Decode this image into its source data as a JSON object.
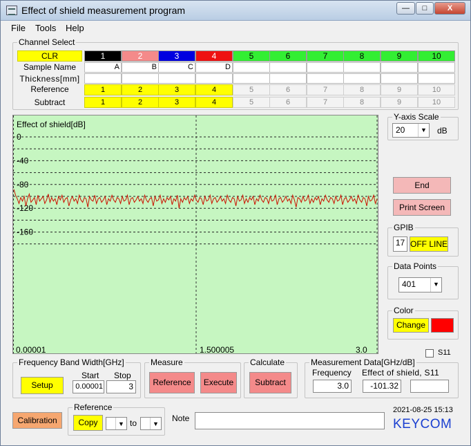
{
  "window": {
    "title": "Effect of shield measurement program",
    "minimize_label": "—",
    "maximize_label": "□",
    "close_label": "X"
  },
  "menu": {
    "file": "File",
    "tools": "Tools",
    "help": "Help"
  },
  "channel_select": {
    "title": "Channel Select",
    "clr_label": "CLR",
    "row_labels": {
      "sample_name": "Sample Name",
      "thickness": "Thickness[mm]",
      "reference": "Reference",
      "subtract": "Subtract"
    },
    "channels": [
      {
        "label": "1",
        "color": "#000000",
        "text_color": "#ffffff",
        "sample_name": "A",
        "reference": "1",
        "subtract": "1"
      },
      {
        "label": "2",
        "color": "#f48a8a",
        "text_color": "#ffffff",
        "sample_name": "B",
        "reference": "2",
        "subtract": "2"
      },
      {
        "label": "3",
        "color": "#0000e0",
        "text_color": "#ffffff",
        "sample_name": "C",
        "reference": "3",
        "subtract": "3"
      },
      {
        "label": "4",
        "color": "#ee1111",
        "text_color": "#ffffff",
        "sample_name": "D",
        "reference": "4",
        "subtract": "4"
      },
      {
        "label": "5",
        "color": "#33ee33",
        "text_color": "#000000",
        "sample_name": "",
        "reference": "5",
        "subtract": "5"
      },
      {
        "label": "6",
        "color": "#33ee33",
        "text_color": "#000000",
        "sample_name": "",
        "reference": "6",
        "subtract": "6"
      },
      {
        "label": "7",
        "color": "#33ee33",
        "text_color": "#000000",
        "sample_name": "",
        "reference": "7",
        "subtract": "7"
      },
      {
        "label": "8",
        "color": "#33ee33",
        "text_color": "#000000",
        "sample_name": "",
        "reference": "8",
        "subtract": "8"
      },
      {
        "label": "9",
        "color": "#33ee33",
        "text_color": "#000000",
        "sample_name": "",
        "reference": "9",
        "subtract": "9"
      },
      {
        "label": "10",
        "color": "#33ee33",
        "text_color": "#000000",
        "sample_name": "",
        "reference": "10",
        "subtract": "10"
      }
    ]
  },
  "chart_data": {
    "type": "line",
    "title": "",
    "ylabel": "Effect of shield[dB]",
    "xlabel": "",
    "y_ticks": [
      "0",
      "-40",
      "-80",
      "-120",
      "-160"
    ],
    "x_ticks": [
      "0.00001",
      "1.500005",
      "3.0"
    ],
    "ylim": [
      -180,
      0
    ],
    "xlim": [
      1e-05,
      3.0
    ],
    "grid": true,
    "background": "#c6f6c1",
    "series": [
      {
        "color": "#cc1100",
        "y": [
          -88,
          -98,
          -104,
          -112,
          -102,
          -108,
          -100,
          -116,
          -104,
          -96,
          -110,
          -106,
          -102,
          -114,
          -98,
          -108,
          -104,
          -100,
          -112,
          -106,
          -96,
          -110,
          -102,
          -108,
          -104,
          -114,
          -100,
          -106,
          -98,
          -110,
          -104,
          -102,
          -116,
          -106,
          -100,
          -108,
          -104,
          -112,
          -98,
          -106,
          -110,
          -102,
          -104,
          -118,
          -100,
          -106,
          -108,
          -98,
          -112,
          -104,
          -102,
          -110,
          -106,
          -100,
          -114,
          -104,
          -108,
          -98,
          -106,
          -110,
          -102,
          -104,
          -112,
          -100,
          -108,
          -106,
          -98,
          -114,
          -104,
          -102,
          -110,
          -106,
          -100,
          -108,
          -104,
          -112,
          -98,
          -106,
          -110,
          -104,
          -102,
          -116,
          -100,
          -108,
          -106,
          -98,
          -112,
          -104,
          -110,
          -102,
          -106,
          -100,
          -114,
          -104,
          -108,
          -98,
          -120,
          -104,
          -110,
          -102,
          -106,
          -100,
          -112,
          -104,
          -108,
          -98,
          -106,
          -110,
          -102,
          -104,
          -114,
          -100,
          -108,
          -106,
          -98,
          -112,
          -104,
          -102,
          -110,
          -106,
          -100,
          -108,
          -104,
          -112,
          -98,
          -106,
          -110,
          -102,
          -104,
          -116,
          -100,
          -108,
          -106,
          -98,
          -112,
          -104,
          -110,
          -102,
          -106,
          -100,
          -114,
          -104,
          -108,
          -98,
          -106,
          -110,
          -102,
          -104,
          -112,
          -100,
          -108,
          -106,
          -98,
          -114,
          -104,
          -102,
          -110,
          -106,
          -100,
          -108,
          -104,
          -112,
          -98,
          -106,
          -118,
          -102,
          -104,
          -110,
          -100,
          -108,
          -106,
          -98,
          -112,
          -104,
          -110,
          -102,
          -106,
          -100,
          -114,
          -104,
          -108,
          -98,
          -106,
          -110,
          -102,
          -104,
          -112,
          -100,
          -108,
          -106,
          -98,
          -114,
          -104,
          -102,
          -110,
          -106,
          -100,
          -108,
          -104,
          -112,
          -98,
          -106,
          -110,
          -102,
          -104,
          -116,
          -100,
          -108,
          -106,
          -98,
          -112,
          -104
        ]
      }
    ]
  },
  "y_axis_scale": {
    "title": "Y-axis Scale",
    "value": "20",
    "unit": "dB"
  },
  "buttons": {
    "end": "End",
    "print_screen": "Print Screen",
    "setup": "Setup",
    "reference": "Reference",
    "execute": "Execute",
    "subtract": "Subtract",
    "calibration": "Calibration",
    "copy": "Copy",
    "change": "Change",
    "off_line": "OFF LINE"
  },
  "gpib": {
    "title": "GPIB",
    "address": "17"
  },
  "data_points": {
    "title": "Data Points",
    "value": "401"
  },
  "color_group": {
    "title": "Color",
    "swatch": "#ff0000"
  },
  "s11_label": "S11",
  "freq_band": {
    "title": "Frequency Band Width[GHz]",
    "start_label": "Start",
    "stop_label": "Stop",
    "start_value": "0.00001",
    "stop_value": "3"
  },
  "measure": {
    "title": "Measure"
  },
  "calculate": {
    "title": "Calculate"
  },
  "measurement_data": {
    "title": "Measurement Data[GHz/dB]",
    "freq_label": "Frequency",
    "effect_label": "Effect of shield, S11",
    "freq_value": "3.0",
    "effect_value": "-101.32",
    "s11_value": ""
  },
  "reference_copy": {
    "title": "Reference",
    "to_label": "to"
  },
  "note_label": "Note",
  "timestamp": "2021-08-25 15:13",
  "brand": "KEYCOM"
}
